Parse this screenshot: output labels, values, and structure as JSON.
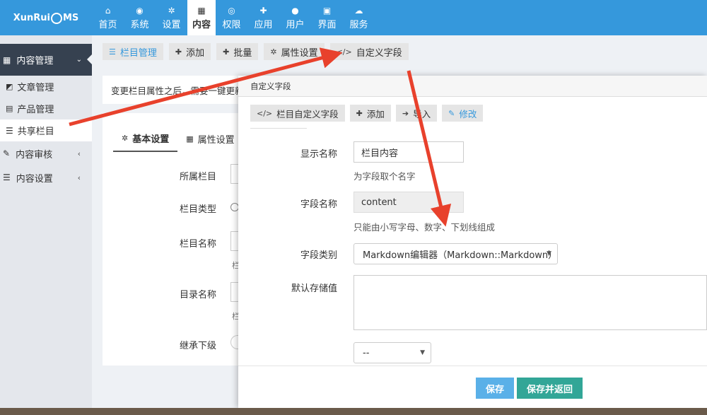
{
  "app": {
    "logo_text": "XunRuiCMS",
    "logo_left": "XunRui",
    "logo_right": "MS"
  },
  "nav": [
    {
      "label": "首页",
      "icon": "home-icon",
      "glyph": "⌂"
    },
    {
      "label": "系统",
      "icon": "globe-icon",
      "glyph": "◉"
    },
    {
      "label": "设置",
      "icon": "gears-icon",
      "glyph": "✲"
    },
    {
      "label": "内容",
      "icon": "grid-icon",
      "glyph": "▦",
      "active": true
    },
    {
      "label": "权限",
      "icon": "user-circle-icon",
      "glyph": "◎"
    },
    {
      "label": "应用",
      "icon": "puzzle-icon",
      "glyph": "✚"
    },
    {
      "label": "用户",
      "icon": "user-icon",
      "glyph": "●"
    },
    {
      "label": "界面",
      "icon": "html5-icon",
      "glyph": "▣"
    },
    {
      "label": "服务",
      "icon": "cloud-icon",
      "glyph": "☁"
    }
  ],
  "sidebar": {
    "header": "内容管理",
    "items": [
      {
        "label": "文章管理",
        "icon": "edit-square-icon"
      },
      {
        "label": "产品管理",
        "icon": "briefcase-icon"
      },
      {
        "label": "共享栏目",
        "icon": "bars-icon",
        "active": true
      }
    ],
    "groups": [
      {
        "label": "内容审核",
        "icon": "edit-icon"
      },
      {
        "label": "内容设置",
        "icon": "bars-icon"
      }
    ]
  },
  "toolbar": {
    "category_manage": "栏目管理",
    "add": "添加",
    "batch": "批量",
    "attr_settings": "属性设置",
    "custom_fields": "自定义字段"
  },
  "main": {
    "note": "变更栏目属性之后，需要一键更新栏",
    "tab_basic": "基本设置",
    "tab_attr": "属性设置",
    "labels": {
      "parent": "所属栏目",
      "type": "栏目类型",
      "name": "栏目名称",
      "dir": "目录名称",
      "inherit": "继承下级"
    },
    "hint_char": "栏"
  },
  "dialog": {
    "title": "自定义字段",
    "tools": {
      "custom_fields": "栏目自定义字段",
      "add": "添加",
      "import": "导入",
      "edit": "修改"
    },
    "fields": {
      "display_name_label": "显示名称",
      "display_name_value": "栏目内容",
      "display_name_help": "为字段取个名字",
      "field_name_label": "字段名称",
      "field_name_value": "content",
      "field_name_help": "只能由小写字母、数字、下划线组成",
      "field_type_label": "字段类别",
      "field_type_value": "Markdown编辑器（Markdown::Markdown）",
      "default_label": "默认存储值",
      "extra_select_value": "--"
    },
    "buttons": {
      "save": "保存",
      "save_back": "保存并返回"
    }
  },
  "colors": {
    "topbar": "#3598dc",
    "sidebar_header": "#364150",
    "arrow": "#e8412c",
    "save": "#5ab0e8",
    "save_back": "#32a697"
  }
}
